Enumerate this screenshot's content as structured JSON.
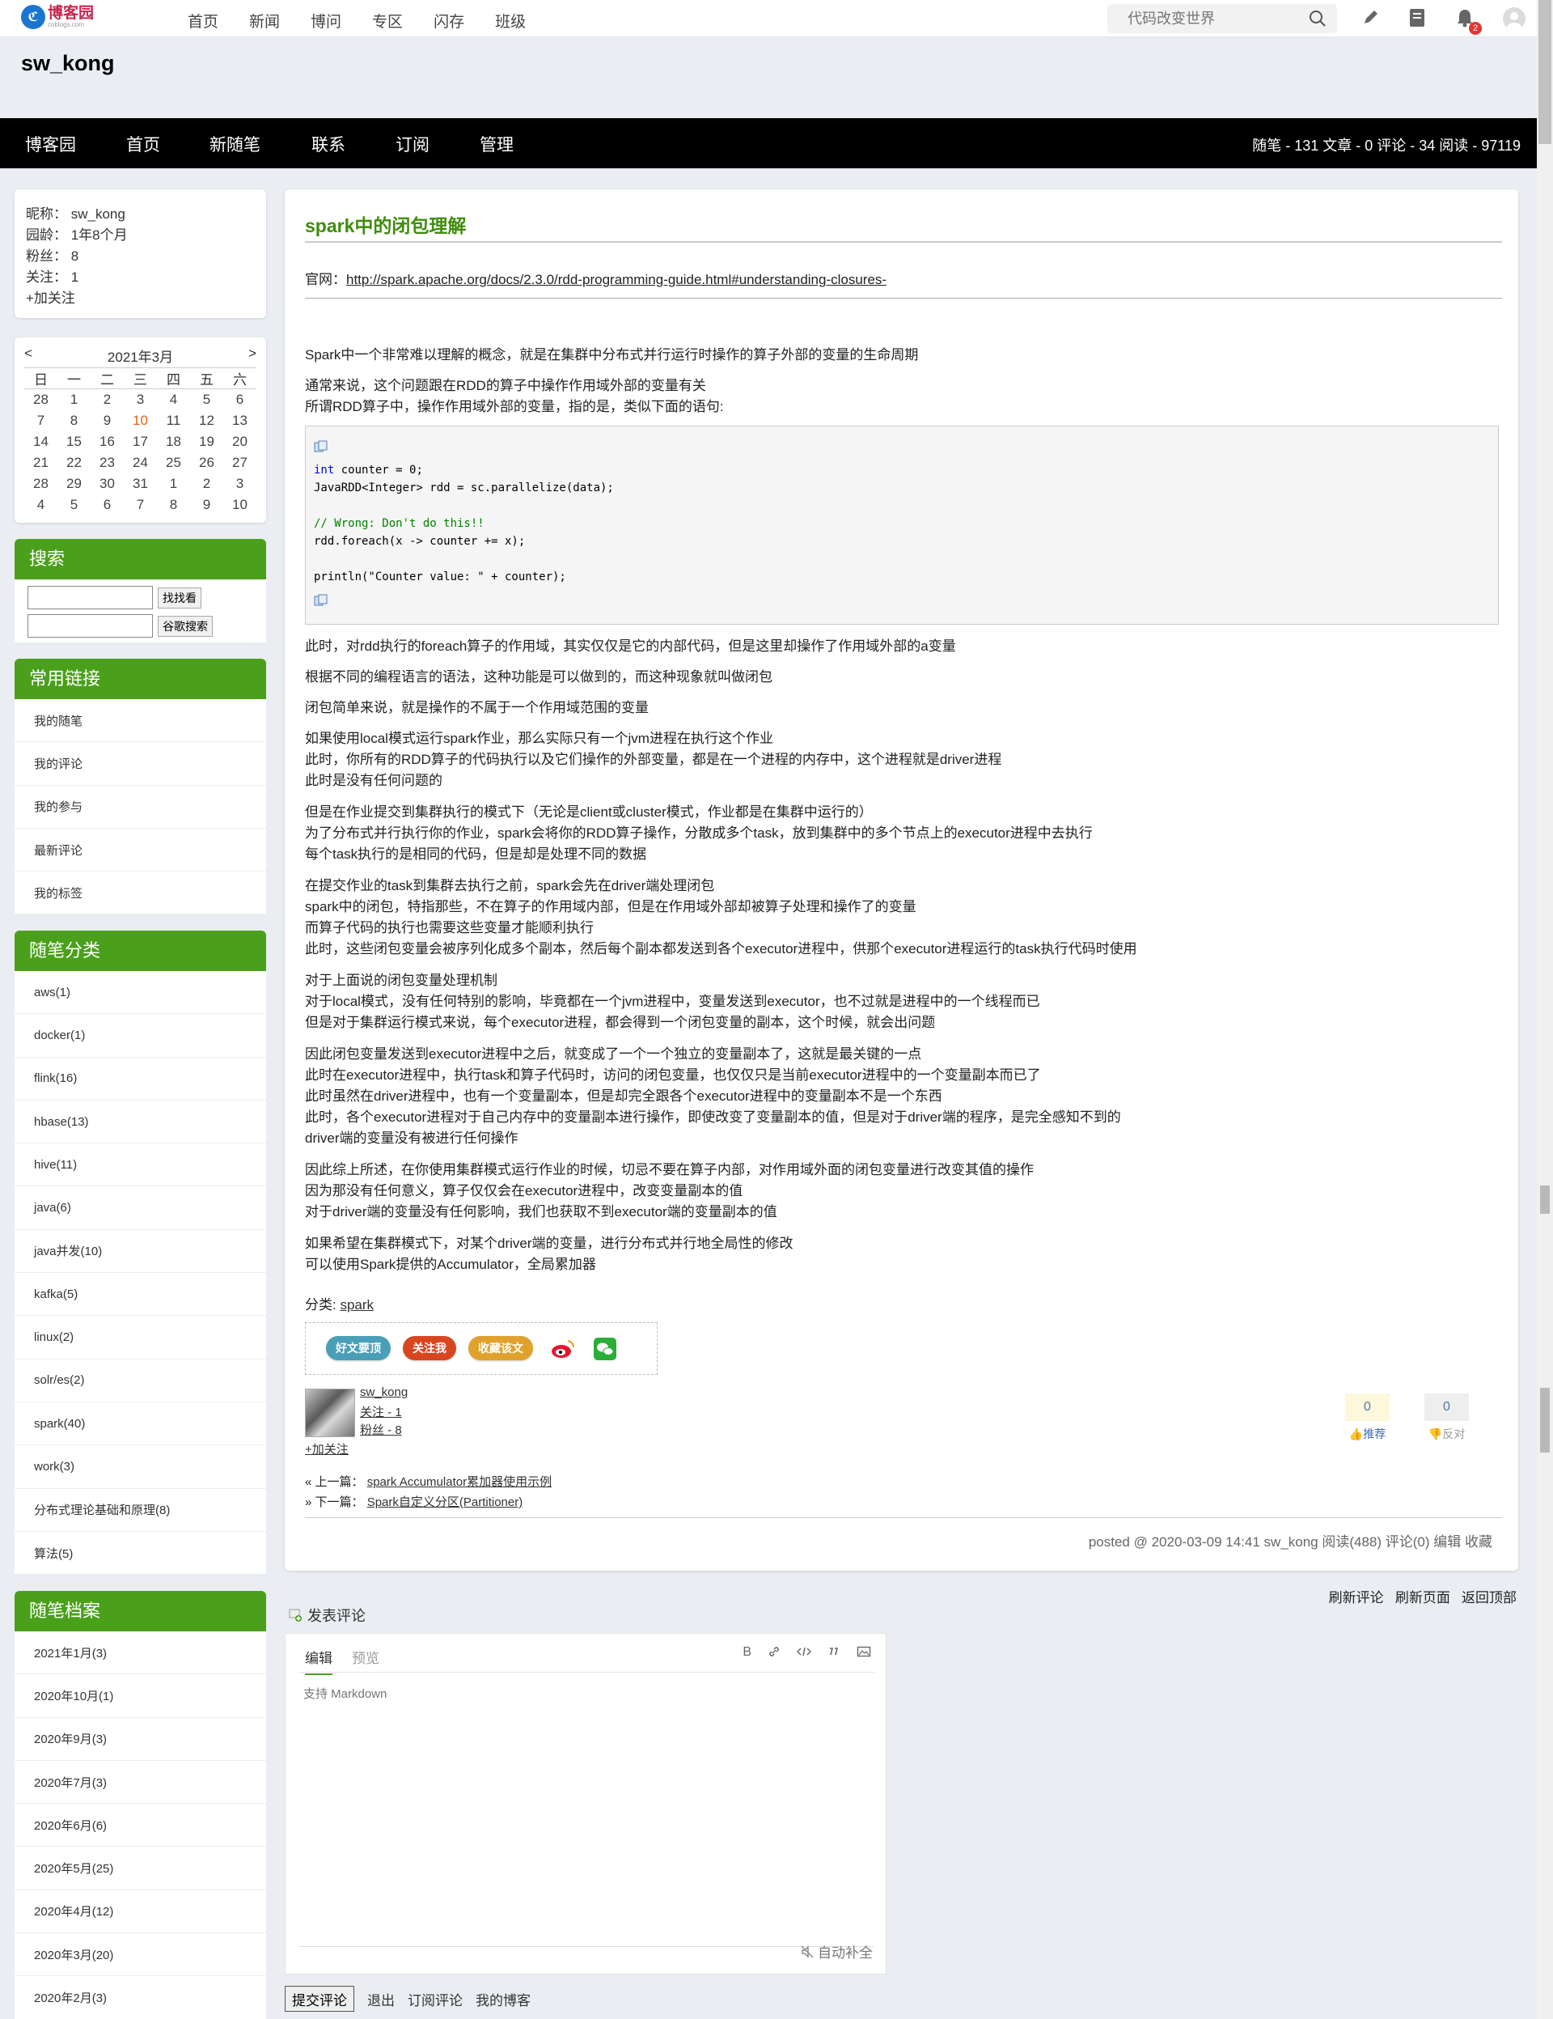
{
  "topbar": {
    "logo_cn": "博客园",
    "logo_en": "cnblogs.com",
    "nav": [
      "首页",
      "新闻",
      "博问",
      "专区",
      "闪存",
      "班级"
    ],
    "search_placeholder": "代码改变世界",
    "notification_count": "2"
  },
  "blog": {
    "title": "sw_kong",
    "nav": [
      "博客园",
      "首页",
      "新随笔",
      "联系",
      "订阅",
      "管理"
    ],
    "stats": "随笔 - 131  文章 - 0  评论 - 34  阅读 - 97119"
  },
  "profile": {
    "nickname": "昵称：  sw_kong",
    "age": "园龄：  1年8个月",
    "fans": "粉丝：  8",
    "follow": "关注：  1",
    "add_follow": "+加关注"
  },
  "calendar": {
    "prev": "<",
    "month": "2021年3月",
    "next": ">",
    "weekdays": [
      "日",
      "一",
      "二",
      "三",
      "四",
      "五",
      "六"
    ],
    "weeks": [
      [
        "28",
        "1",
        "2",
        "3",
        "4",
        "5",
        "6"
      ],
      [
        "7",
        "8",
        "9",
        "10",
        "11",
        "12",
        "13"
      ],
      [
        "14",
        "15",
        "16",
        "17",
        "18",
        "19",
        "20"
      ],
      [
        "21",
        "22",
        "23",
        "24",
        "25",
        "26",
        "27"
      ],
      [
        "28",
        "29",
        "30",
        "31",
        "1",
        "2",
        "3"
      ],
      [
        "4",
        "5",
        "6",
        "7",
        "8",
        "9",
        "10"
      ]
    ],
    "today": "10"
  },
  "sidebar": {
    "search_title": "搜索",
    "search_btn": "找找看",
    "google_btn": "谷歌搜索",
    "links_title": "常用链接",
    "links": [
      "我的随笔",
      "我的评论",
      "我的参与",
      "最新评论",
      "我的标签"
    ],
    "categories_title": "随笔分类",
    "categories": [
      "aws(1)",
      "docker(1)",
      "flink(16)",
      "hbase(13)",
      "hive(11)",
      "java(6)",
      "java并发(10)",
      "kafka(5)",
      "linux(2)",
      "solr/es(2)",
      "spark(40)",
      "work(3)",
      "分布式理论基础和原理(8)",
      "算法(5)"
    ],
    "archive_title": "随笔档案",
    "archive": [
      "2021年1月(3)",
      "2020年10月(1)",
      "2020年9月(3)",
      "2020年7月(3)",
      "2020年6月(6)",
      "2020年5月(25)",
      "2020年4月(12)",
      "2020年3月(20)",
      "2020年2月(3)"
    ]
  },
  "post": {
    "title": "spark中的闭包理解",
    "official_label": "官网：",
    "official_url": "http://spark.apache.org/docs/2.3.0/rdd-programming-guide.html#understanding-closures-",
    "p1": "Spark中一个非常难以理解的概念，就是在集群中分布式并行运行时操作的算子外部的变量的生命周期",
    "p2a": "通常来说，这个问题跟在RDD的算子中操作作用域外部的变量有关",
    "p2b": "所谓RDD算子中，操作作用域外部的变量，指的是，类似下面的语句:",
    "code": {
      "l1_kw": "int",
      "l1_rest": " counter = 0;",
      "l2": "JavaRDD<Integer> rdd = sc.parallelize(data);",
      "l3": "// Wrong: Don't do this!!",
      "l4": "rdd.foreach(x -> counter += x);",
      "l5": "println(\"Counter value: \" + counter);"
    },
    "p3": "此时，对rdd执行的foreach算子的作用域，其实仅仅是它的内部代码，但是这里却操作了作用域外部的a变量",
    "p4": "根据不同的编程语言的语法，这种功能是可以做到的，而这种现象就叫做闭包",
    "p5": "闭包简单来说，就是操作的不属于一个作用域范围的变量",
    "p6a": "如果使用local模式运行spark作业，那么实际只有一个jvm进程在执行这个作业",
    "p6b": "此时，你所有的RDD算子的代码执行以及它们操作的外部变量，都是在一个进程的内存中，这个进程就是driver进程",
    "p6c": "此时是没有任何问题的",
    "p7a": "但是在作业提交到集群执行的模式下（无论是client或cluster模式，作业都是在集群中运行的）",
    "p7b": "为了分布式并行执行你的作业，spark会将你的RDD算子操作，分散成多个task，放到集群中的多个节点上的executor进程中去执行",
    "p7c": "每个task执行的是相同的代码，但是却是处理不同的数据",
    "p8a": "在提交作业的task到集群去执行之前，spark会先在driver端处理闭包",
    "p8b": "spark中的闭包，特指那些，不在算子的作用域内部，但是在作用域外部却被算子处理和操作了的变量",
    "p8c": "而算子代码的执行也需要这些变量才能顺利执行",
    "p8d": "此时，这些闭包变量会被序列化成多个副本，然后每个副本都发送到各个executor进程中，供那个executor进程运行的task执行代码时使用",
    "p9a": "对于上面说的闭包变量处理机制",
    "p9b": "对于local模式，没有任何特别的影响，毕竟都在一个jvm进程中，变量发送到executor，也不过就是进程中的一个线程而已",
    "p9c": "但是对于集群运行模式来说，每个executor进程，都会得到一个闭包变量的副本，这个时候，就会出问题",
    "p10a": "因此闭包变量发送到executor进程中之后，就变成了一个一个独立的变量副本了，这就是最关键的一点",
    "p10b": "此时在executor进程中，执行task和算子代码时，访问的闭包变量，也仅仅只是当前executor进程中的一个变量副本而已了",
    "p10c": "此时虽然在driver进程中，也有一个变量副本，但是却完全跟各个executor进程中的变量副本不是一个东西",
    "p10d": "此时，各个executor进程对于自己内存中的变量副本进行操作，即使改变了变量副本的值，但是对于driver端的程序，是完全感知不到的",
    "p10e": "driver端的变量没有被进行任何操作",
    "p11a": "因此综上所述，在你使用集群模式运行作业的时候，切忌不要在算子内部，对作用域外面的闭包变量进行改变其值的操作",
    "p11b": "因为那没有任何意义，算子仅仅会在executor进程中，改变变量副本的值",
    "p11c": "对于driver端的变量没有任何影响，我们也获取不到executor端的变量副本的值",
    "p12a": "如果希望在集群模式下，对某个driver端的变量，进行分布式并行地全局性的修改",
    "p12b": "可以使用Spark提供的Accumulator，全局累加器",
    "category_label": "分类: ",
    "category": "spark",
    "share": [
      "好文要顶",
      "关注我",
      "收藏该文"
    ],
    "author": "sw_kong",
    "author_follow": "关注 - 1",
    "author_fans": "粉丝 - 8",
    "author_add": "+加关注",
    "digg_count": "0",
    "digg_label": "推荐",
    "bury_count": "0",
    "bury_label": "反对",
    "prev_label": "« 上一篇：",
    "prev_title": "spark Accumulator累加器使用示例",
    "next_label": "» 下一篇：",
    "next_title": "Spark自定义分区(Partitioner)",
    "meta": "posted @ 2020-03-09 14:41  sw_kong  阅读(488)  评论(0)  编辑  收藏"
  },
  "comments": {
    "actions": [
      "刷新评论",
      "刷新页面",
      "返回顶部"
    ],
    "title": "发表评论",
    "tab_edit": "编辑",
    "tab_preview": "预览",
    "tools": [
      "B",
      "link",
      "code",
      "quote",
      "image"
    ],
    "placeholder": "支持 Markdown",
    "autocomplete": "自动补全",
    "submit": "提交评论",
    "logout": "退出",
    "subscribe": "订阅评论",
    "my_blog": "我的博客"
  },
  "colors": {
    "accent_green": "#4aa01a",
    "title_green": "#3f8d0c",
    "navbar": "#000000"
  }
}
